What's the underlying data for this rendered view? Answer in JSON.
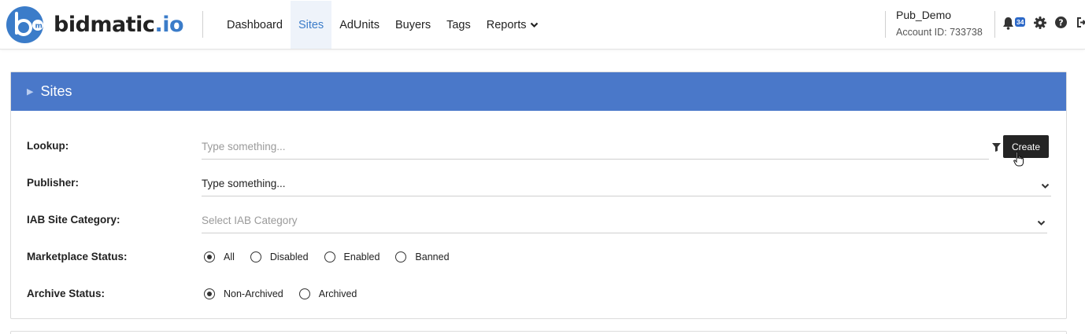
{
  "brand": {
    "name": "bidmatic",
    "suffix": ".io",
    "accent": "#3b7cc9"
  },
  "nav": {
    "items": [
      {
        "label": "Dashboard"
      },
      {
        "label": "Sites"
      },
      {
        "label": "AdUnits"
      },
      {
        "label": "Buyers"
      },
      {
        "label": "Tags"
      },
      {
        "label": "Reports"
      }
    ],
    "active": "Sites"
  },
  "account": {
    "name": "Pub_Demo",
    "id_text": "Account ID: 733738"
  },
  "notifications": {
    "count": "34"
  },
  "panel": {
    "title": "Sites",
    "header_color": "#4a78c9",
    "lookup": {
      "label": "Lookup:",
      "placeholder": "Type something..."
    },
    "publisher": {
      "label": "Publisher:",
      "value": "Type something..."
    },
    "iab": {
      "label": "IAB Site Category:",
      "placeholder": "Select IAB Category"
    },
    "marketplace": {
      "label": "Marketplace Status:",
      "options": [
        "All",
        "Disabled",
        "Enabled",
        "Banned"
      ],
      "selected": "All"
    },
    "archive": {
      "label": "Archive Status:",
      "options": [
        "Non-Archived",
        "Archived"
      ],
      "selected": "Non-Archived"
    },
    "create_label": "Create"
  },
  "icons": [
    "bell-icon",
    "gear-icon",
    "help-icon",
    "logout-icon",
    "filter-icon",
    "chevron-down-icon",
    "hand-cursor-icon"
  ]
}
